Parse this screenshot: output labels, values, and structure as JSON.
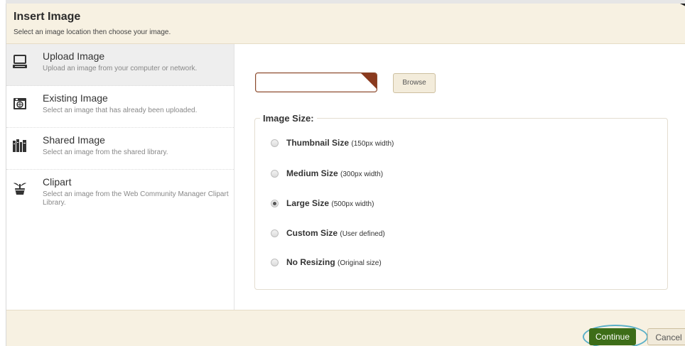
{
  "dialog": {
    "title": "Insert Image",
    "subtitle": "Select an image location then choose your image."
  },
  "sidebar": {
    "items": [
      {
        "label": "Upload Image",
        "desc": "Upload an image from your computer or network.",
        "icon": "computer-icon",
        "active": true
      },
      {
        "label": "Existing Image",
        "desc": "Select an image that has already been uploaded.",
        "icon": "photo-icon",
        "active": false
      },
      {
        "label": "Shared Image",
        "desc": "Select an image from the shared library.",
        "icon": "library-books-icon",
        "active": false
      },
      {
        "label": "Clipart",
        "desc": "Select an image from the Web Community Manager Clipart Library.",
        "icon": "plant-pot-icon",
        "active": false
      }
    ]
  },
  "upload": {
    "file_value": "",
    "browse_label": "Browse"
  },
  "image_size": {
    "legend": "Image Size:",
    "selected": "Large Size",
    "options": [
      {
        "label": "Thumbnail Size",
        "note": "(150px width)",
        "checked": false
      },
      {
        "label": "Medium Size",
        "note": "(300px width)",
        "checked": false
      },
      {
        "label": "Large Size",
        "note": "(500px width)",
        "checked": true
      },
      {
        "label": "Custom Size",
        "note": "(User defined)",
        "checked": false
      },
      {
        "label": "No Resizing",
        "note": "(Original size)",
        "checked": false
      }
    ]
  },
  "footer": {
    "continue_label": "Continue",
    "cancel_label": "Cancel"
  },
  "colors": {
    "header_bg": "#f7f1e2",
    "continue_bg": "#3d6d18",
    "highlight_ring": "#5ab0c8",
    "input_border": "#8a4a2e"
  }
}
